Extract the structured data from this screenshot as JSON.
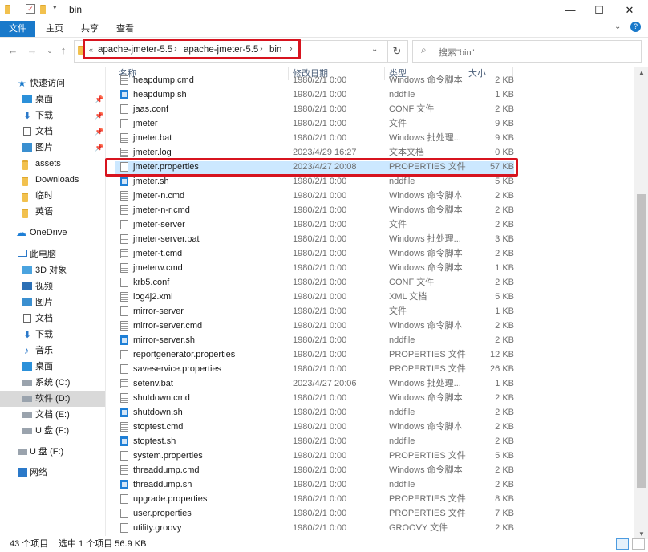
{
  "window": {
    "title": "bin"
  },
  "ribbon": {
    "tabs": [
      "文件",
      "主页",
      "共享",
      "查看"
    ]
  },
  "address": {
    "crumbs": [
      "apache-jmeter-5.5",
      "apache-jmeter-5.5",
      "bin"
    ],
    "search_placeholder": "搜索\"bin\""
  },
  "sidebar": {
    "quick_access": "快速访问",
    "quick_items": [
      {
        "label": "桌面",
        "icon": "desktop-icon"
      },
      {
        "label": "下载",
        "icon": "download-icon"
      },
      {
        "label": "文档",
        "icon": "document-icon"
      },
      {
        "label": "图片",
        "icon": "picture-icon"
      },
      {
        "label": "assets",
        "icon": "folder-icon"
      },
      {
        "label": "Downloads",
        "icon": "folder-icon"
      },
      {
        "label": "临时",
        "icon": "folder-icon"
      },
      {
        "label": "英语",
        "icon": "folder-icon"
      }
    ],
    "onedrive": "OneDrive",
    "this_pc": "此电脑",
    "pc_items": [
      {
        "label": "3D 对象",
        "icon": "3d-objects-icon"
      },
      {
        "label": "视频",
        "icon": "video-icon"
      },
      {
        "label": "图片",
        "icon": "picture-icon"
      },
      {
        "label": "文档",
        "icon": "document-icon"
      },
      {
        "label": "下载",
        "icon": "download-icon"
      },
      {
        "label": "音乐",
        "icon": "music-icon"
      },
      {
        "label": "桌面",
        "icon": "desktop-icon"
      },
      {
        "label": "系统 (C:)",
        "icon": "drive-icon"
      },
      {
        "label": "软件 (D:)",
        "icon": "drive-icon"
      },
      {
        "label": "文档 (E:)",
        "icon": "drive-icon"
      },
      {
        "label": "U 盘 (F:)",
        "icon": "usb-drive-icon"
      }
    ],
    "usb": "U 盘 (F:)",
    "network": "网络"
  },
  "columns": {
    "name": "名称",
    "date": "修改日期",
    "type": "类型",
    "size": "大小"
  },
  "files": [
    {
      "name": "heapdump.cmd",
      "date": "1980/2/1 0:00",
      "type": "Windows 命令脚本",
      "size": "2 KB",
      "icon": "cmd"
    },
    {
      "name": "heapdump.sh",
      "date": "1980/2/1 0:00",
      "type": "nddfile",
      "size": "1 KB",
      "icon": "sh"
    },
    {
      "name": "jaas.conf",
      "date": "1980/2/1 0:00",
      "type": "CONF 文件",
      "size": "2 KB",
      "icon": "doc"
    },
    {
      "name": "jmeter",
      "date": "1980/2/1 0:00",
      "type": "文件",
      "size": "9 KB",
      "icon": "doc"
    },
    {
      "name": "jmeter.bat",
      "date": "1980/2/1 0:00",
      "type": "Windows 批处理...",
      "size": "9 KB",
      "icon": "cmd"
    },
    {
      "name": "jmeter.log",
      "date": "2023/4/29 16:27",
      "type": "文本文档",
      "size": "0 KB",
      "icon": "cmd"
    },
    {
      "name": "jmeter.properties",
      "date": "2023/4/27 20:08",
      "type": "PROPERTIES 文件",
      "size": "57 KB",
      "icon": "doc"
    },
    {
      "name": "jmeter.sh",
      "date": "1980/2/1 0:00",
      "type": "nddfile",
      "size": "5 KB",
      "icon": "sh"
    },
    {
      "name": "jmeter-n.cmd",
      "date": "1980/2/1 0:00",
      "type": "Windows 命令脚本",
      "size": "2 KB",
      "icon": "cmd"
    },
    {
      "name": "jmeter-n-r.cmd",
      "date": "1980/2/1 0:00",
      "type": "Windows 命令脚本",
      "size": "2 KB",
      "icon": "cmd"
    },
    {
      "name": "jmeter-server",
      "date": "1980/2/1 0:00",
      "type": "文件",
      "size": "2 KB",
      "icon": "doc"
    },
    {
      "name": "jmeter-server.bat",
      "date": "1980/2/1 0:00",
      "type": "Windows 批处理...",
      "size": "3 KB",
      "icon": "cmd"
    },
    {
      "name": "jmeter-t.cmd",
      "date": "1980/2/1 0:00",
      "type": "Windows 命令脚本",
      "size": "2 KB",
      "icon": "cmd"
    },
    {
      "name": "jmeterw.cmd",
      "date": "1980/2/1 0:00",
      "type": "Windows 命令脚本",
      "size": "1 KB",
      "icon": "cmd"
    },
    {
      "name": "krb5.conf",
      "date": "1980/2/1 0:00",
      "type": "CONF 文件",
      "size": "2 KB",
      "icon": "doc"
    },
    {
      "name": "log4j2.xml",
      "date": "1980/2/1 0:00",
      "type": "XML 文档",
      "size": "5 KB",
      "icon": "cmd"
    },
    {
      "name": "mirror-server",
      "date": "1980/2/1 0:00",
      "type": "文件",
      "size": "1 KB",
      "icon": "doc"
    },
    {
      "name": "mirror-server.cmd",
      "date": "1980/2/1 0:00",
      "type": "Windows 命令脚本",
      "size": "2 KB",
      "icon": "cmd"
    },
    {
      "name": "mirror-server.sh",
      "date": "1980/2/1 0:00",
      "type": "nddfile",
      "size": "2 KB",
      "icon": "sh"
    },
    {
      "name": "reportgenerator.properties",
      "date": "1980/2/1 0:00",
      "type": "PROPERTIES 文件",
      "size": "12 KB",
      "icon": "doc"
    },
    {
      "name": "saveservice.properties",
      "date": "1980/2/1 0:00",
      "type": "PROPERTIES 文件",
      "size": "26 KB",
      "icon": "doc"
    },
    {
      "name": "setenv.bat",
      "date": "2023/4/27 20:06",
      "type": "Windows 批处理...",
      "size": "1 KB",
      "icon": "cmd"
    },
    {
      "name": "shutdown.cmd",
      "date": "1980/2/1 0:00",
      "type": "Windows 命令脚本",
      "size": "2 KB",
      "icon": "cmd"
    },
    {
      "name": "shutdown.sh",
      "date": "1980/2/1 0:00",
      "type": "nddfile",
      "size": "2 KB",
      "icon": "sh"
    },
    {
      "name": "stoptest.cmd",
      "date": "1980/2/1 0:00",
      "type": "Windows 命令脚本",
      "size": "2 KB",
      "icon": "cmd"
    },
    {
      "name": "stoptest.sh",
      "date": "1980/2/1 0:00",
      "type": "nddfile",
      "size": "2 KB",
      "icon": "sh"
    },
    {
      "name": "system.properties",
      "date": "1980/2/1 0:00",
      "type": "PROPERTIES 文件",
      "size": "5 KB",
      "icon": "doc"
    },
    {
      "name": "threaddump.cmd",
      "date": "1980/2/1 0:00",
      "type": "Windows 命令脚本",
      "size": "2 KB",
      "icon": "cmd"
    },
    {
      "name": "threaddump.sh",
      "date": "1980/2/1 0:00",
      "type": "nddfile",
      "size": "2 KB",
      "icon": "sh"
    },
    {
      "name": "upgrade.properties",
      "date": "1980/2/1 0:00",
      "type": "PROPERTIES 文件",
      "size": "8 KB",
      "icon": "doc"
    },
    {
      "name": "user.properties",
      "date": "1980/2/1 0:00",
      "type": "PROPERTIES 文件",
      "size": "7 KB",
      "icon": "doc"
    },
    {
      "name": "utility.groovy",
      "date": "1980/2/1 0:00",
      "type": "GROOVY 文件",
      "size": "2 KB",
      "icon": "doc"
    }
  ],
  "status": {
    "count": "43 个项目",
    "selected": "选中 1 个项目  56.9 KB"
  },
  "colors": {
    "accent": "#1979ca",
    "highlight": "#d7141f",
    "selection": "#cce8ff"
  }
}
